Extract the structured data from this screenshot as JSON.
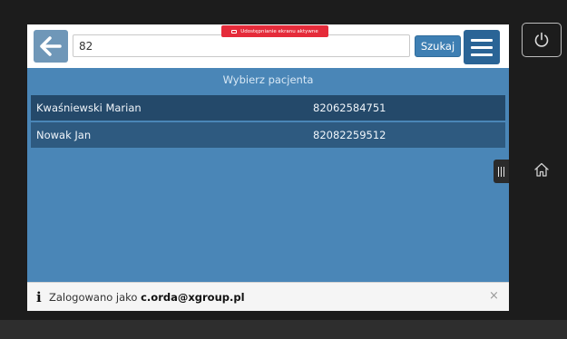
{
  "topbar": {
    "search_value": "82",
    "search_label": "Szukaj",
    "share_badge": "Udostępnianie ekranu aktywne"
  },
  "list": {
    "title": "Wybierz pacjenta",
    "rows": [
      {
        "name": "Kwaśniewski Marian",
        "pesel": "82062584751"
      },
      {
        "name": "Nowak Jan",
        "pesel": "82082259512"
      }
    ]
  },
  "infobar": {
    "icon": "i",
    "prefix": "Zalogowano jako ",
    "user": "c.orda@xgroup.pl",
    "close": "×"
  },
  "device": {
    "icons": [
      "power-icon",
      "home-icon",
      "back-arrow-icon",
      "hamburger-menu-icon",
      "screen-share-icon",
      "drag-handle-icon"
    ]
  },
  "colors": {
    "screen_bg": "#4a86b7",
    "row_dark": "#24496a",
    "row_mid": "#2e5a80",
    "menu_btn": "#2a6496",
    "badge_red": "#e52b3a"
  }
}
